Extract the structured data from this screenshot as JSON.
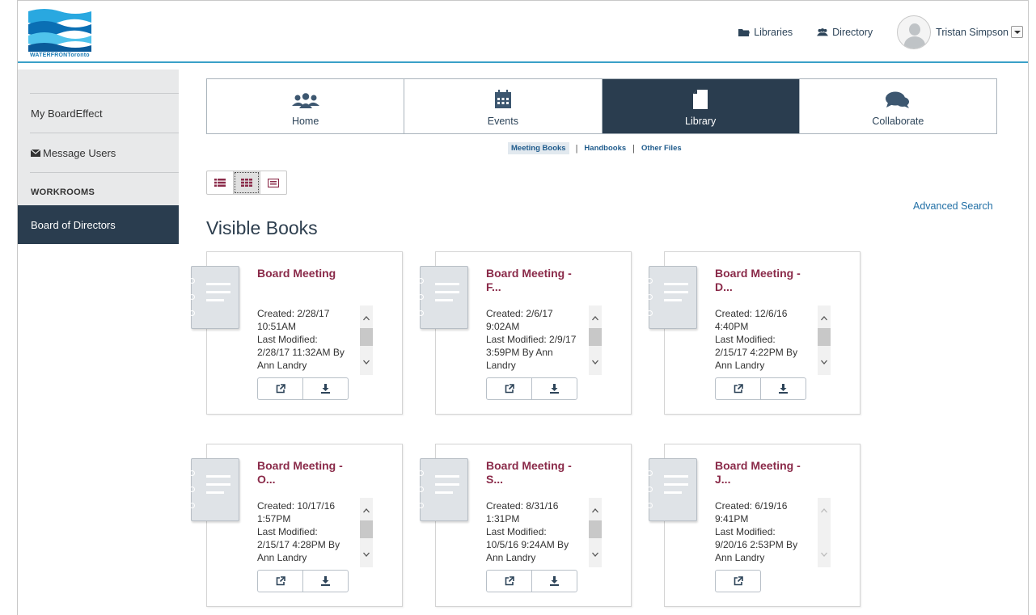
{
  "header": {
    "logo_text": "WATERFRONToronto",
    "libraries_label": "Libraries",
    "directory_label": "Directory",
    "user_name": "Tristan Simpson"
  },
  "sidebar": {
    "items": [
      {
        "label": "My BoardEffect"
      },
      {
        "label": "Message Users"
      },
      {
        "label": "WORKROOMS"
      },
      {
        "label": "Board of Directors"
      }
    ]
  },
  "tabs": [
    {
      "label": "Home",
      "icon": "users-icon"
    },
    {
      "label": "Events",
      "icon": "calendar-icon"
    },
    {
      "label": "Library",
      "icon": "document-icon",
      "active": true
    },
    {
      "label": "Collaborate",
      "icon": "chat-icon"
    }
  ],
  "subnav": {
    "meeting_books": "Meeting Books",
    "handbooks": "Handbooks",
    "other_files": "Other Files"
  },
  "advanced_search": "Advanced Search",
  "section_title": "Visible Books",
  "colors": {
    "accent_dark": "#2a3d4f",
    "title_maroon": "#8a2a49",
    "link_blue": "#1f6ea5",
    "header_rule": "#3aa0c8"
  },
  "books": [
    {
      "title_line1": "Board Meeting",
      "title_line2": "",
      "created_line1": "Created: 2/28/17",
      "created_line2": "10:51AM",
      "modified_line1": "Last Modified:",
      "modified_line2": "2/28/17 11:32AM By",
      "modified_line3": "Ann Landry",
      "download": true
    },
    {
      "title_line1": "Board Meeting -",
      "title_line2": "F...",
      "created_line1": "Created: 2/6/17",
      "created_line2": "9:02AM",
      "modified_line1": "Last Modified: 2/9/17",
      "modified_line2": "3:59PM By Ann",
      "modified_line3": "Landry",
      "download": true
    },
    {
      "title_line1": "Board Meeting -",
      "title_line2": "D...",
      "created_line1": "Created: 12/6/16",
      "created_line2": "4:40PM",
      "modified_line1": "Last Modified:",
      "modified_line2": "2/15/17 4:22PM By",
      "modified_line3": "Ann Landry",
      "download": true
    },
    {
      "title_line1": "Board Meeting -",
      "title_line2": "O...",
      "created_line1": "Created: 10/17/16",
      "created_line2": "1:57PM",
      "modified_line1": "Last Modified:",
      "modified_line2": "2/15/17 4:28PM By",
      "modified_line3": "Ann Landry",
      "download": true
    },
    {
      "title_line1": "Board Meeting -",
      "title_line2": "S...",
      "created_line1": "Created: 8/31/16",
      "created_line2": "1:31PM",
      "modified_line1": "Last Modified:",
      "modified_line2": "10/5/16 9:24AM By",
      "modified_line3": "Ann Landry",
      "download": true
    },
    {
      "title_line1": "Board Meeting -",
      "title_line2": "J...",
      "created_line1": "Created: 6/19/16",
      "created_line2": "9:41PM",
      "modified_line1": "Last Modified:",
      "modified_line2": "9/20/16 2:53PM By",
      "modified_line3": "Ann Landry",
      "download": false
    }
  ]
}
